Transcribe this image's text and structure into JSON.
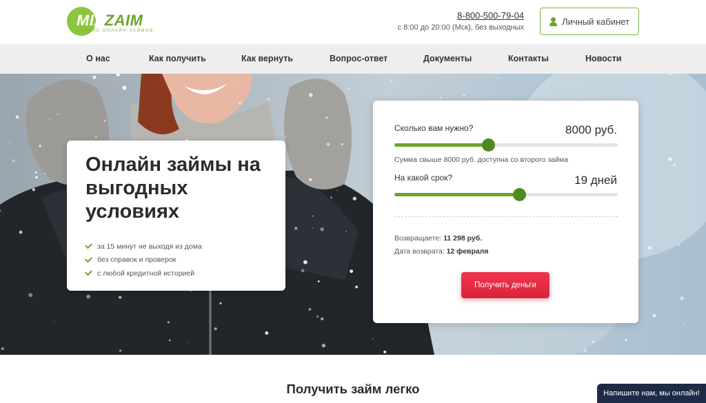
{
  "header": {
    "logo": {
      "brand_a": "MIX",
      "brand_b": "ZAIM",
      "tagline": "СЕРВИС ОНЛАЙН-ЗАЙМОВ"
    },
    "phone": "8-800-500-79-04",
    "hours": "с 8:00 до 20:00 (Мск), без выходных",
    "cabinet_label": "Личный кабинет"
  },
  "nav": {
    "items": [
      {
        "label": "О нас"
      },
      {
        "label": "Как получить"
      },
      {
        "label": "Как вернуть"
      },
      {
        "label": "Вопрос-ответ"
      },
      {
        "label": "Документы"
      },
      {
        "label": "Контакты"
      },
      {
        "label": "Новости"
      }
    ]
  },
  "promo": {
    "title": "Онлайн займы на выгодных условиях",
    "features": [
      "за 15 минут не выходя из дома",
      "без справок и проверок",
      "с любой кредитной историей"
    ]
  },
  "calculator": {
    "amount_question": "Сколько вам нужно?",
    "amount_value": "8000 руб.",
    "amount_slider_fraction": 0.42,
    "amount_note": "Сумма свыше 8000 руб. доступна со второго займа",
    "term_question": "На какой срок?",
    "term_value": "19 дней",
    "term_slider_fraction": 0.56,
    "repay_label": "Возвращаете:",
    "repay_value": "11 298 руб.",
    "date_label": "Дата возврата:",
    "date_value": "12 февраля",
    "submit_label": "Получить деньги"
  },
  "section_title": "Получить займ легко",
  "chat_label": "Напишите нам, мы онлайн!",
  "colors": {
    "accent_green": "#6aa52d",
    "button_red": "#e22d45",
    "chat_bg": "#1e2b47",
    "nav_bg": "#eeeeee"
  }
}
